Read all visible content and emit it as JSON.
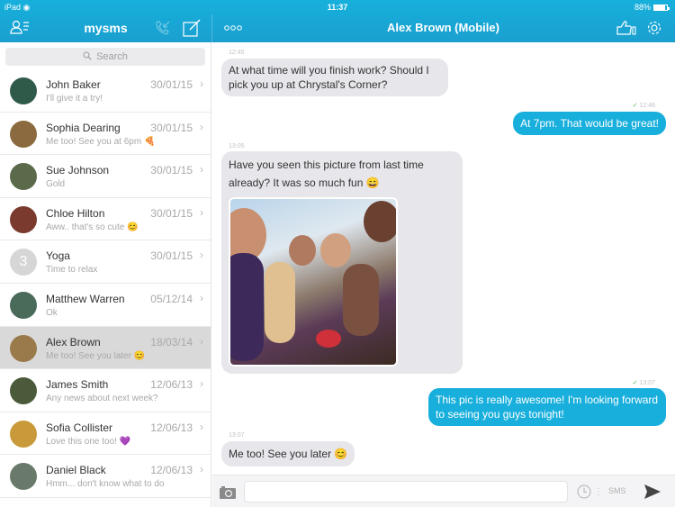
{
  "status_bar": {
    "device": "iPad",
    "time": "11:37",
    "battery": "88%",
    "battery_level": 0.88
  },
  "sidebar": {
    "title": "mysms",
    "search_placeholder": "Search",
    "conversations": [
      {
        "name": "John Baker",
        "preview": "I'll give it a try!",
        "date": "30/01/15",
        "avatar_color": "#2f5a4a",
        "active": false
      },
      {
        "name": "Sophia Dearing",
        "preview": "Me too! See you at 6pm 🍕",
        "date": "30/01/15",
        "avatar_color": "#8a6a3e",
        "active": false
      },
      {
        "name": "Sue Johnson",
        "preview": "Gold",
        "date": "30/01/15",
        "avatar_color": "#5b6a4a",
        "active": false
      },
      {
        "name": "Chloe Hilton",
        "preview": "Aww.. that's so cute 😊",
        "date": "30/01/15",
        "avatar_color": "#7a3a2e",
        "active": false
      },
      {
        "name": "Yoga",
        "preview": "Time to relax",
        "date": "30/01/15",
        "avatar_color": "#d6d6d6",
        "avatar_text": "3",
        "active": false
      },
      {
        "name": "Matthew Warren",
        "preview": "Ok",
        "date": "05/12/14",
        "avatar_color": "#4a6a5a",
        "active": false
      },
      {
        "name": "Alex Brown",
        "preview": "Me too! See you later 😊",
        "date": "18/03/14",
        "avatar_color": "#9a7a4a",
        "active": true
      },
      {
        "name": "James Smith",
        "preview": "Any news about next week?",
        "date": "12/06/13",
        "avatar_color": "#4a5a3a",
        "active": false
      },
      {
        "name": "Sofia Collister",
        "preview": "Love this one too! 💜",
        "date": "12/06/13",
        "avatar_color": "#c89a3a",
        "active": false
      },
      {
        "name": "Daniel Black",
        "preview": "Hmm... don't know what to do",
        "date": "12/06/13",
        "avatar_color": "#6a7a6a",
        "active": false
      }
    ]
  },
  "chat": {
    "title": "Alex Brown (Mobile)",
    "messages": [
      {
        "direction": "in",
        "time": "12:45",
        "text": "At what time will you finish work? Should I pick you up at Chrystal's Corner?"
      },
      {
        "direction": "out",
        "time": "12:46",
        "text": "At 7pm. That would be great!",
        "delivered": true
      },
      {
        "direction": "in",
        "time": "13:05",
        "text": "Have you seen this picture from last time already? It was so much fun 😄",
        "has_photo": true
      },
      {
        "direction": "out",
        "time": "13:07",
        "text": "This pic is really awesome! I'm looking forward to seeing you guys tonight!",
        "delivered": true
      },
      {
        "direction": "in",
        "time": "13:07",
        "text": "Me too! See you later 😊"
      }
    ],
    "check_mark": "✓"
  },
  "composer": {
    "input_value": "",
    "mode_label": "SMS"
  },
  "colors": {
    "brand": "#18afdc",
    "incoming_bubble": "#e6e6eb",
    "active_row": "#d9d9d9"
  }
}
